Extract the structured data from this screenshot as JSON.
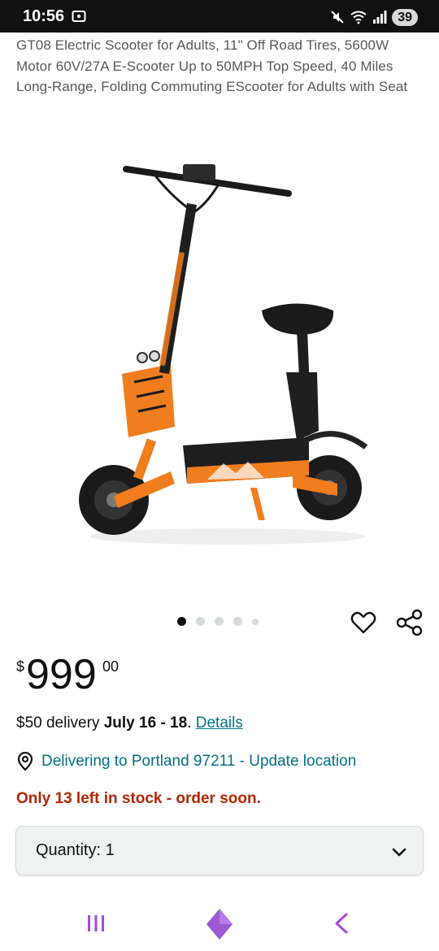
{
  "status_bar": {
    "time": "10:56",
    "battery": "39",
    "icons": [
      "screenshot-icon",
      "mute-icon",
      "wifi-icon",
      "signal-icon",
      "battery-icon"
    ]
  },
  "product": {
    "title": "GT08 Electric Scooter for Adults, 11\" Off Road Tires, 5600W Motor 60V/27A E-Scooter Up to 50MPH Top Speed, 40 Miles Long-Range, Folding Commuting EScooter for Adults with Seat",
    "image_icon": "electric-scooter-image",
    "carousel": {
      "count": 5,
      "active_index": 0
    }
  },
  "price": {
    "symbol": "$",
    "whole": "999",
    "fraction": "00"
  },
  "delivery": {
    "prefix": "$50 delivery ",
    "date": "July 16 - 18",
    "suffix": ". ",
    "details_link": "Details"
  },
  "location": {
    "text": "Delivering to Portland 97211 - Update location"
  },
  "stock": {
    "text": "Only 13 left in stock - order soon."
  },
  "quantity": {
    "label": "Quantity: 1"
  },
  "colors": {
    "link": "#007185",
    "stock_warning": "#b12704",
    "nav_purple": "#a64bd9",
    "scooter_orange": "#f07d1e"
  }
}
